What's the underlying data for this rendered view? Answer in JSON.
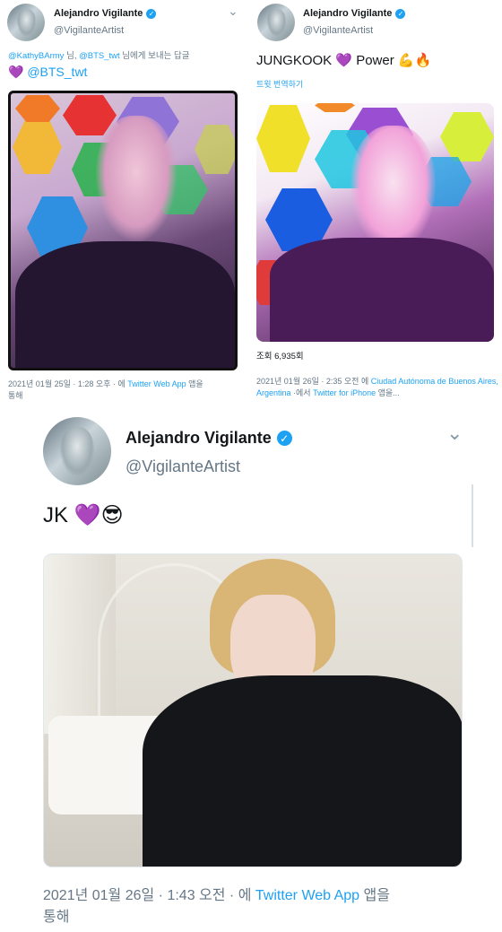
{
  "tweet1": {
    "name": "Alejandro Vigilante",
    "handle": "@VigilanteArtist",
    "reply_mention1": "@KathyBArmy",
    "reply_sep1": " 님, ",
    "reply_mention2": "@BTS_twt",
    "reply_suffix": " 님에게 보내는 답글",
    "heart": "💜",
    "body_mention": "@BTS_twt",
    "meta_date": "2021년 01월 25일 · 1:28 오후 · 에 ",
    "meta_app": "Twitter Web App",
    "meta_suffix": " 앱을",
    "meta_line2": "통해"
  },
  "tweet2": {
    "name": "Alejandro Vigilante",
    "handle": "@VigilanteArtist",
    "body_text": "JUNGKOOK ",
    "body_heart": "💜",
    "body_word": " Power ",
    "body_emoji": "💪🔥",
    "translate": "트윗 번역하기",
    "views": "조회 6,935회",
    "meta_date": "2021년 01월 26일 · 2:35 오전 에 ",
    "meta_place": "Ciudad Autónoma de Buenos Aires, Argentina",
    "meta_mid": " ·에서 ",
    "meta_app": "Twitter for iPhone",
    "meta_suffix": " 앱을..."
  },
  "tweet3": {
    "name": "Alejandro Vigilante",
    "handle": "@VigilanteArtist",
    "body_text": "JK ",
    "body_heart": "💜",
    "body_emoji": "😎",
    "meta_date": "2021년 01월 26일 · 1:43 오전 · 에 ",
    "meta_app": "Twitter Web App",
    "meta_suffix": " 앱을",
    "meta_line2": "통해"
  },
  "icons": {
    "verified": "✓",
    "chevron": "⌄"
  },
  "colors": {
    "link": "#1da1f2",
    "secondary_text": "#657786",
    "heart": "#a98ddb"
  }
}
